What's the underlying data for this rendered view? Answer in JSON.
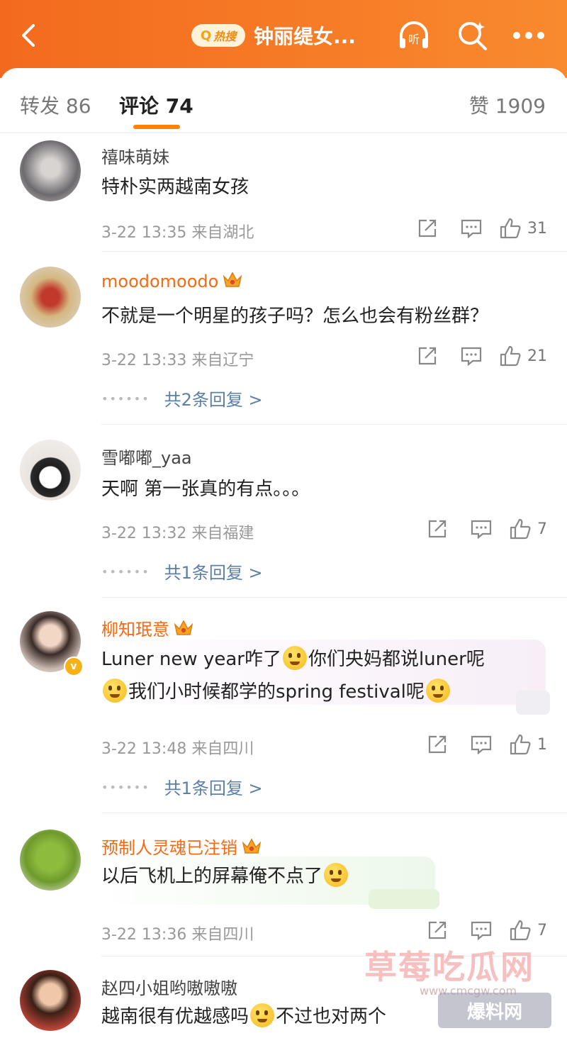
{
  "header": {
    "hot_search_badge": "热搜",
    "title": "钟丽缇女...",
    "icons": [
      "back-icon",
      "listen-icon",
      "search-icon",
      "more-icon"
    ]
  },
  "tabs": {
    "repost": "转发 86",
    "comments": "评论 74",
    "likes": "赞 1909"
  },
  "comments": [
    {
      "user": "禧味萌妹",
      "text": "特朴实两越南女孩",
      "time": "3-22 13:35 来自湖北",
      "likes": "31"
    },
    {
      "user": "moodomoodo",
      "text": "不就是一个明星的孩子吗？怎么也会有粉丝群？",
      "time": "3-22 13:33 来自辽宁",
      "likes": "21",
      "replies": "共2条回复 >"
    },
    {
      "user": "雪嘟嘟_yaa",
      "text": "天啊 第一张真的有点。。。",
      "time": "3-22 13:32 来自福建",
      "likes": "7",
      "replies": "共1条回复 >"
    },
    {
      "user": "柳知珉意",
      "text_line1_a": "Luner new year咋了",
      "text_line1_b": "你们央妈都说luner呢",
      "text_line2": "我们小时候都学的spring festival呢",
      "time": "3-22 13:48 来自四川",
      "likes": "1",
      "replies": "共1条回复 >"
    },
    {
      "user": "预制人灵魂已注销",
      "text": "以后飞机上的屏幕俺不点了",
      "time": "3-22 13:36 来自四川",
      "likes": "7"
    },
    {
      "user": "赵四小姐哟嗷嗷嗷",
      "text_a": "越南很有优越感吗",
      "text_b": "不过也对两个"
    }
  ],
  "watermark": {
    "main": "草莓吃瓜网",
    "url": "www.cmcgw.com",
    "badge": "爆料网"
  }
}
